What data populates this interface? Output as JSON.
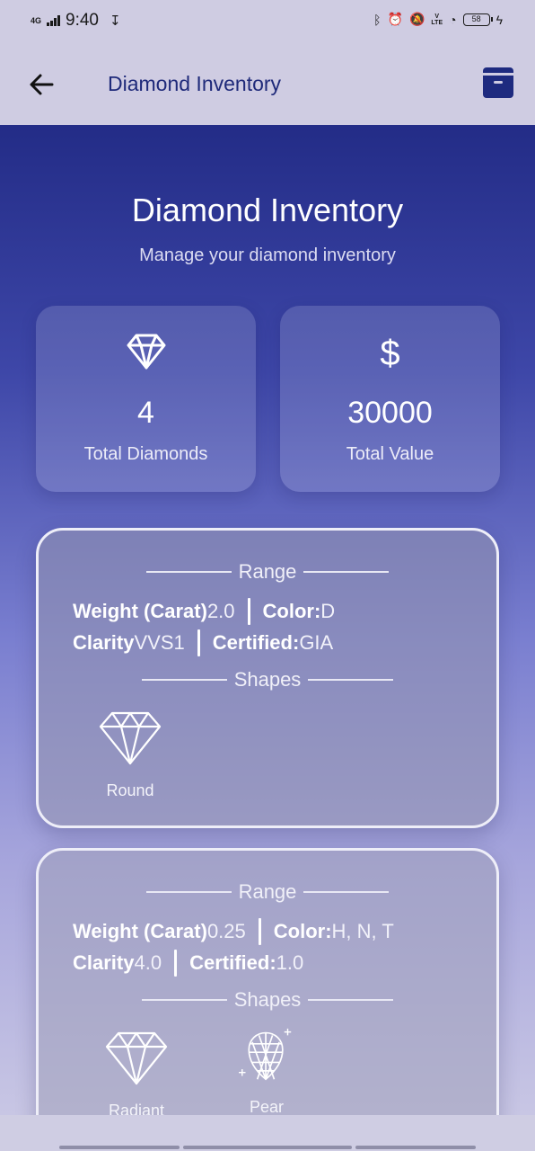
{
  "status_bar": {
    "network": "4G",
    "time": "9:40",
    "battery": "58"
  },
  "app_bar": {
    "title": "Diamond Inventory"
  },
  "hero": {
    "title": "Diamond Inventory",
    "subtitle": "Manage your diamond inventory"
  },
  "stats": [
    {
      "value": "4",
      "label": "Total Diamonds",
      "icon": "diamond-icon"
    },
    {
      "value": "30000",
      "label": "Total Value",
      "icon": "dollar-icon",
      "symbol": "$"
    }
  ],
  "records": [
    {
      "range_label": "Range",
      "weight_label": "Weight (Carat)",
      "weight": "2.0",
      "color_label": "Color:",
      "color": "D",
      "clarity_label": "Clarity",
      "clarity": "VVS1",
      "certified_label": "Certified:",
      "certified": "GIA",
      "shapes_label": "Shapes",
      "shapes": [
        {
          "name": "Round",
          "icon": "round-diamond-icon"
        }
      ]
    },
    {
      "range_label": "Range",
      "weight_label": "Weight (Carat)",
      "weight": "0.25",
      "color_label": "Color:",
      "color": "H, N, T",
      "clarity_label": "Clarity",
      "clarity": "4.0",
      "certified_label": "Certified:",
      "certified": "1.0",
      "shapes_label": "Shapes",
      "shapes": [
        {
          "name": "Radiant",
          "icon": "radiant-diamond-icon"
        },
        {
          "name": "Pear",
          "icon": "pear-diamond-icon"
        }
      ]
    }
  ]
}
